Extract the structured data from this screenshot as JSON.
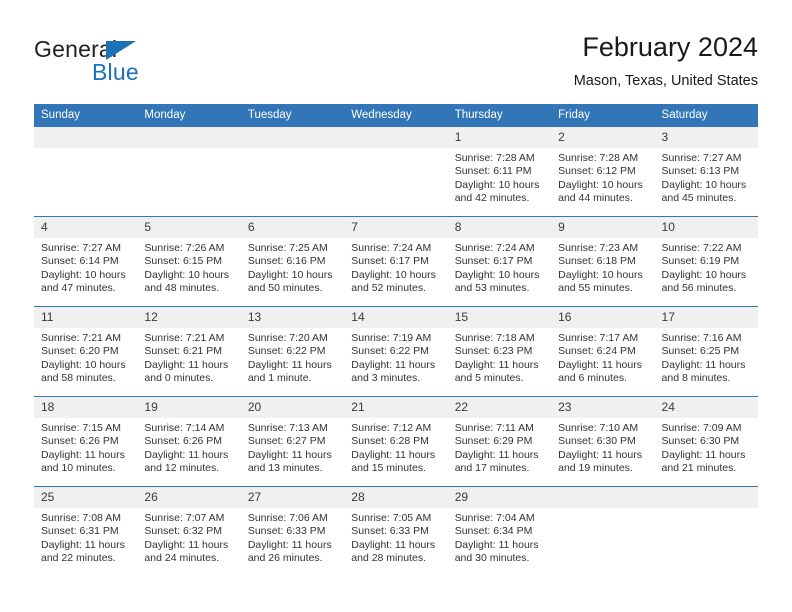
{
  "brand": {
    "word_one": "General",
    "word_two": "Blue",
    "icon": "triangle-logo"
  },
  "header": {
    "title": "February 2024",
    "location": "Mason, Texas, United States"
  },
  "calendar": {
    "weekday_headers": [
      "Sunday",
      "Monday",
      "Tuesday",
      "Wednesday",
      "Thursday",
      "Friday",
      "Saturday"
    ],
    "accent_color": "#3276b8",
    "daynum_bg": "#f0f0f0",
    "weeks": [
      [
        {
          "day": "",
          "empty": true
        },
        {
          "day": "",
          "empty": true
        },
        {
          "day": "",
          "empty": true
        },
        {
          "day": "",
          "empty": true
        },
        {
          "day": "1",
          "sunrise": "Sunrise: 7:28 AM",
          "sunset": "Sunset: 6:11 PM",
          "daylight": "Daylight: 10 hours and 42 minutes."
        },
        {
          "day": "2",
          "sunrise": "Sunrise: 7:28 AM",
          "sunset": "Sunset: 6:12 PM",
          "daylight": "Daylight: 10 hours and 44 minutes."
        },
        {
          "day": "3",
          "sunrise": "Sunrise: 7:27 AM",
          "sunset": "Sunset: 6:13 PM",
          "daylight": "Daylight: 10 hours and 45 minutes."
        }
      ],
      [
        {
          "day": "4",
          "sunrise": "Sunrise: 7:27 AM",
          "sunset": "Sunset: 6:14 PM",
          "daylight": "Daylight: 10 hours and 47 minutes."
        },
        {
          "day": "5",
          "sunrise": "Sunrise: 7:26 AM",
          "sunset": "Sunset: 6:15 PM",
          "daylight": "Daylight: 10 hours and 48 minutes."
        },
        {
          "day": "6",
          "sunrise": "Sunrise: 7:25 AM",
          "sunset": "Sunset: 6:16 PM",
          "daylight": "Daylight: 10 hours and 50 minutes."
        },
        {
          "day": "7",
          "sunrise": "Sunrise: 7:24 AM",
          "sunset": "Sunset: 6:17 PM",
          "daylight": "Daylight: 10 hours and 52 minutes."
        },
        {
          "day": "8",
          "sunrise": "Sunrise: 7:24 AM",
          "sunset": "Sunset: 6:17 PM",
          "daylight": "Daylight: 10 hours and 53 minutes."
        },
        {
          "day": "9",
          "sunrise": "Sunrise: 7:23 AM",
          "sunset": "Sunset: 6:18 PM",
          "daylight": "Daylight: 10 hours and 55 minutes."
        },
        {
          "day": "10",
          "sunrise": "Sunrise: 7:22 AM",
          "sunset": "Sunset: 6:19 PM",
          "daylight": "Daylight: 10 hours and 56 minutes."
        }
      ],
      [
        {
          "day": "11",
          "sunrise": "Sunrise: 7:21 AM",
          "sunset": "Sunset: 6:20 PM",
          "daylight": "Daylight: 10 hours and 58 minutes."
        },
        {
          "day": "12",
          "sunrise": "Sunrise: 7:21 AM",
          "sunset": "Sunset: 6:21 PM",
          "daylight": "Daylight: 11 hours and 0 minutes."
        },
        {
          "day": "13",
          "sunrise": "Sunrise: 7:20 AM",
          "sunset": "Sunset: 6:22 PM",
          "daylight": "Daylight: 11 hours and 1 minute."
        },
        {
          "day": "14",
          "sunrise": "Sunrise: 7:19 AM",
          "sunset": "Sunset: 6:22 PM",
          "daylight": "Daylight: 11 hours and 3 minutes."
        },
        {
          "day": "15",
          "sunrise": "Sunrise: 7:18 AM",
          "sunset": "Sunset: 6:23 PM",
          "daylight": "Daylight: 11 hours and 5 minutes."
        },
        {
          "day": "16",
          "sunrise": "Sunrise: 7:17 AM",
          "sunset": "Sunset: 6:24 PM",
          "daylight": "Daylight: 11 hours and 6 minutes."
        },
        {
          "day": "17",
          "sunrise": "Sunrise: 7:16 AM",
          "sunset": "Sunset: 6:25 PM",
          "daylight": "Daylight: 11 hours and 8 minutes."
        }
      ],
      [
        {
          "day": "18",
          "sunrise": "Sunrise: 7:15 AM",
          "sunset": "Sunset: 6:26 PM",
          "daylight": "Daylight: 11 hours and 10 minutes."
        },
        {
          "day": "19",
          "sunrise": "Sunrise: 7:14 AM",
          "sunset": "Sunset: 6:26 PM",
          "daylight": "Daylight: 11 hours and 12 minutes."
        },
        {
          "day": "20",
          "sunrise": "Sunrise: 7:13 AM",
          "sunset": "Sunset: 6:27 PM",
          "daylight": "Daylight: 11 hours and 13 minutes."
        },
        {
          "day": "21",
          "sunrise": "Sunrise: 7:12 AM",
          "sunset": "Sunset: 6:28 PM",
          "daylight": "Daylight: 11 hours and 15 minutes."
        },
        {
          "day": "22",
          "sunrise": "Sunrise: 7:11 AM",
          "sunset": "Sunset: 6:29 PM",
          "daylight": "Daylight: 11 hours and 17 minutes."
        },
        {
          "day": "23",
          "sunrise": "Sunrise: 7:10 AM",
          "sunset": "Sunset: 6:30 PM",
          "daylight": "Daylight: 11 hours and 19 minutes."
        },
        {
          "day": "24",
          "sunrise": "Sunrise: 7:09 AM",
          "sunset": "Sunset: 6:30 PM",
          "daylight": "Daylight: 11 hours and 21 minutes."
        }
      ],
      [
        {
          "day": "25",
          "sunrise": "Sunrise: 7:08 AM",
          "sunset": "Sunset: 6:31 PM",
          "daylight": "Daylight: 11 hours and 22 minutes."
        },
        {
          "day": "26",
          "sunrise": "Sunrise: 7:07 AM",
          "sunset": "Sunset: 6:32 PM",
          "daylight": "Daylight: 11 hours and 24 minutes."
        },
        {
          "day": "27",
          "sunrise": "Sunrise: 7:06 AM",
          "sunset": "Sunset: 6:33 PM",
          "daylight": "Daylight: 11 hours and 26 minutes."
        },
        {
          "day": "28",
          "sunrise": "Sunrise: 7:05 AM",
          "sunset": "Sunset: 6:33 PM",
          "daylight": "Daylight: 11 hours and 28 minutes."
        },
        {
          "day": "29",
          "sunrise": "Sunrise: 7:04 AM",
          "sunset": "Sunset: 6:34 PM",
          "daylight": "Daylight: 11 hours and 30 minutes."
        },
        {
          "day": "",
          "empty": true
        },
        {
          "day": "",
          "empty": true
        }
      ]
    ]
  }
}
